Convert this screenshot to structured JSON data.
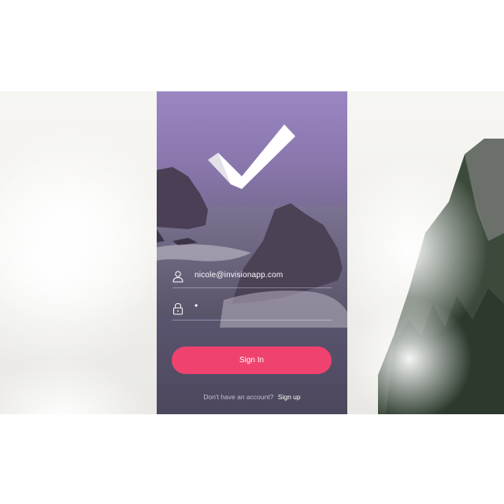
{
  "login": {
    "email_value": "nicole@invisionapp.com",
    "password_value": "•",
    "signin_label": "Sign In",
    "no_account_text": "Don't have an account?",
    "signup_label": "Sign up"
  },
  "icons": {
    "logo": "checkmark-logo-icon",
    "email": "user-icon",
    "password": "lock-icon"
  },
  "colors": {
    "accent": "#f0426f",
    "overlay_top": "#9b86c2",
    "overlay_bottom": "#4c475c"
  }
}
